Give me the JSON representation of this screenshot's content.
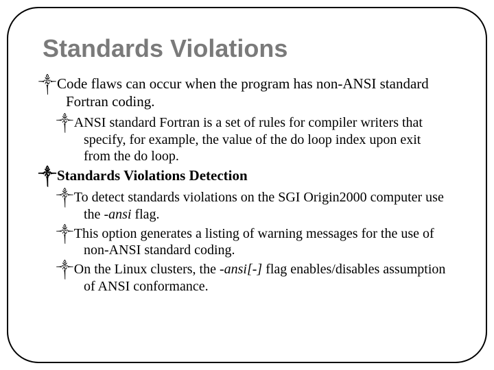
{
  "title": "Standards Violations",
  "p1": "Code flaws can occur when the program has non-ANSI standard Fortran coding.",
  "p1a": "ANSI standard Fortran is a set of rules for compiler writers that specify, for example, the value of the do loop index upon exit from the do loop.",
  "p2": "Standards Violations Detection",
  "p2a_pre": "To detect standards violations on the SGI Origin2000 computer use the ",
  "p2a_flag": "-ansi",
  "p2a_post": " flag.",
  "p2b": "This option generates a listing of warning messages for the use of non-ANSI standard coding.",
  "p2c_pre": "On the Linux clusters, the ",
  "p2c_flag": "-ansi[-]",
  "p2c_post": " flag enables/disables assumption of ANSI conformance.",
  "bullet": "༒"
}
